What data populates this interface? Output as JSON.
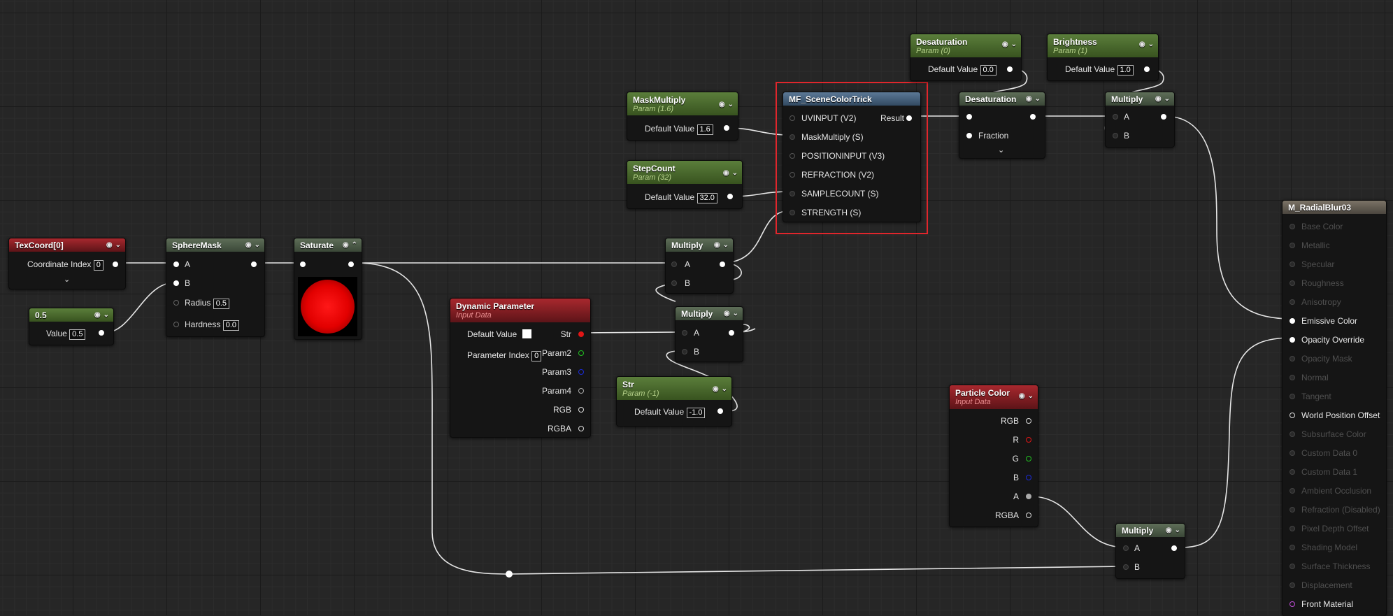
{
  "nodes": {
    "texcoord": {
      "title": "TexCoord[0]",
      "coord_label": "Coordinate Index",
      "coord_value": "0"
    },
    "const05": {
      "title": "0.5",
      "value_label": "Value",
      "value": "0.5"
    },
    "spheremask": {
      "title": "SphereMask",
      "pin_a": "A",
      "pin_b": "B",
      "radius_label": "Radius",
      "radius_value": "0.5",
      "hardness_label": "Hardness",
      "hardness_value": "0.0"
    },
    "saturate": {
      "title": "Saturate"
    },
    "dynparam": {
      "title": "Dynamic Parameter",
      "subtitle": "Input Data",
      "default_label": "Default Value",
      "index_label": "Parameter Index",
      "index_value": "0",
      "out_str": "Str",
      "out_param2": "Param2",
      "out_param3": "Param3",
      "out_param4": "Param4",
      "out_rgb": "RGB",
      "out_rgba": "RGBA"
    },
    "maskmultiply": {
      "title": "MaskMultiply",
      "subtitle": "Param (1.6)",
      "default_label": "Default Value",
      "value": "1.6"
    },
    "stepcount": {
      "title": "StepCount",
      "subtitle": "Param (32)",
      "default_label": "Default Value",
      "value": "32.0"
    },
    "multiply1": {
      "title": "Multiply",
      "pin_a": "A",
      "pin_b": "B"
    },
    "multiply2": {
      "title": "Multiply",
      "pin_a": "A",
      "pin_b": "B"
    },
    "strparam": {
      "title": "Str",
      "subtitle": "Param (-1)",
      "default_label": "Default Value",
      "value": "-1.0"
    },
    "mf": {
      "title": "MF_SceneColorTrick",
      "in1": "UVINPUT (V2)",
      "in2": "MaskMultiply (S)",
      "in3": "POSITIONINPUT (V3)",
      "in4": "REFRACTION (V2)",
      "in5": "SAMPLECOUNT (S)",
      "in6": "STRENGTH (S)",
      "result": "Result"
    },
    "desatparam": {
      "title": "Desaturation",
      "subtitle": "Param (0)",
      "default_label": "Default Value",
      "value": "0.0"
    },
    "brightparam": {
      "title": "Brightness",
      "subtitle": "Param (1)",
      "default_label": "Default Value",
      "value": "1.0"
    },
    "desatnode": {
      "title": "Desaturation",
      "fraction": "Fraction"
    },
    "multiply3": {
      "title": "Multiply",
      "pin_a": "A",
      "pin_b": "B"
    },
    "particle": {
      "title": "Particle Color",
      "subtitle": "Input Data",
      "out_rgb": "RGB",
      "out_r": "R",
      "out_g": "G",
      "out_b": "B",
      "out_a": "A",
      "out_rgba": "RGBA"
    },
    "multiply4": {
      "title": "Multiply",
      "pin_a": "A",
      "pin_b": "B"
    },
    "result": {
      "title": "M_RadialBlur03",
      "inputs": [
        "Base Color",
        "Metallic",
        "Specular",
        "Roughness",
        "Anisotropy",
        "Emissive Color",
        "Opacity Override",
        "Opacity Mask",
        "Normal",
        "Tangent",
        "World Position Offset",
        "Subsurface Color",
        "Custom Data 0",
        "Custom Data 1",
        "Ambient Occlusion",
        "Refraction (Disabled)",
        "Pixel Depth Offset",
        "Shading Model",
        "Surface Thickness",
        "Displacement",
        "Front Material"
      ]
    }
  },
  "colors": {
    "selection": "#e0262c",
    "red_pin": "#e01616",
    "green_pin": "#22c022",
    "blue_pin": "#1b2bd8",
    "material_pin": "#c04ed8",
    "wire": "#e8e8e8"
  },
  "icons": {
    "preview": "circle-gear-icon",
    "collapse": "chevron-down-icon",
    "expand": "chevron-up-icon"
  }
}
